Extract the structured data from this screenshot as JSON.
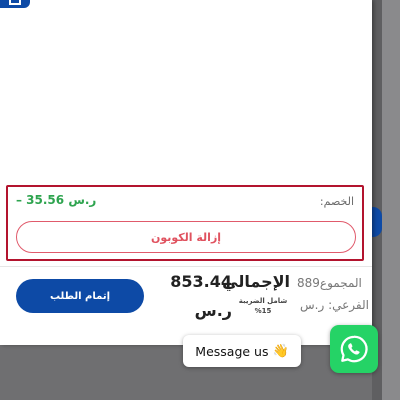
{
  "coupon": {
    "discount_label": "الخصم:",
    "discount_value": "– 35.56 ر.س",
    "remove_label": "إزالة الكوبون"
  },
  "summary": {
    "subtotal_label_line1": "المجموع",
    "subtotal_value": "889",
    "subtotal_label_line2": "الفرعي: ر.س",
    "total_label": "الإجمالي",
    "tax_note": "شامل الضريبة 15%",
    "total_value": "853.44",
    "total_currency": "ر.س"
  },
  "checkout": {
    "label": "إتمام الطلب"
  },
  "chat": {
    "message": "Message us"
  },
  "colors": {
    "accent": "#0d4aa6",
    "discount": "#2ea44f",
    "danger": "#b3142e",
    "whatsapp": "#25d366"
  }
}
